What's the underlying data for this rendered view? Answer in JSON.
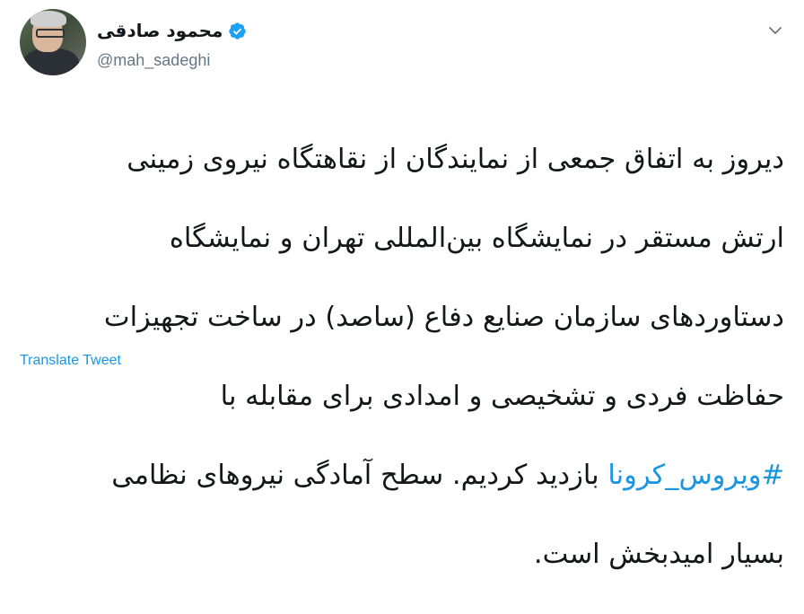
{
  "author": {
    "display_name": "محمود صادقی",
    "handle": "@mah_sadeghi",
    "verified": true
  },
  "tweet": {
    "lines": [
      "دیروز به اتفاق جمعی از نمایندگان از نقاهتگاه نیروی زمینی",
      "ارتش مستقر در نمایشگاه بین‌المللی تهران و نمایشگاه",
      "دستاوردهای سازمان صنایع دفاع (ساصد) در ساخت تجهیزات",
      "حفاظت فردی و تشخیصی و امدادی برای مقابله با"
    ],
    "hashtag": "#ویروس_کرونا",
    "line5_rest": " بازدید کردیم. سطح آمادگی نیروهای نظامی",
    "line6": "بسیار امیدبخش است."
  },
  "actions": {
    "translate_label": "Translate Tweet"
  },
  "icons": {
    "verified": "verified-badge-icon",
    "more": "chevron-down-icon"
  },
  "colors": {
    "link": "#1b95e0",
    "text": "#14171a",
    "secondary": "#657786"
  }
}
